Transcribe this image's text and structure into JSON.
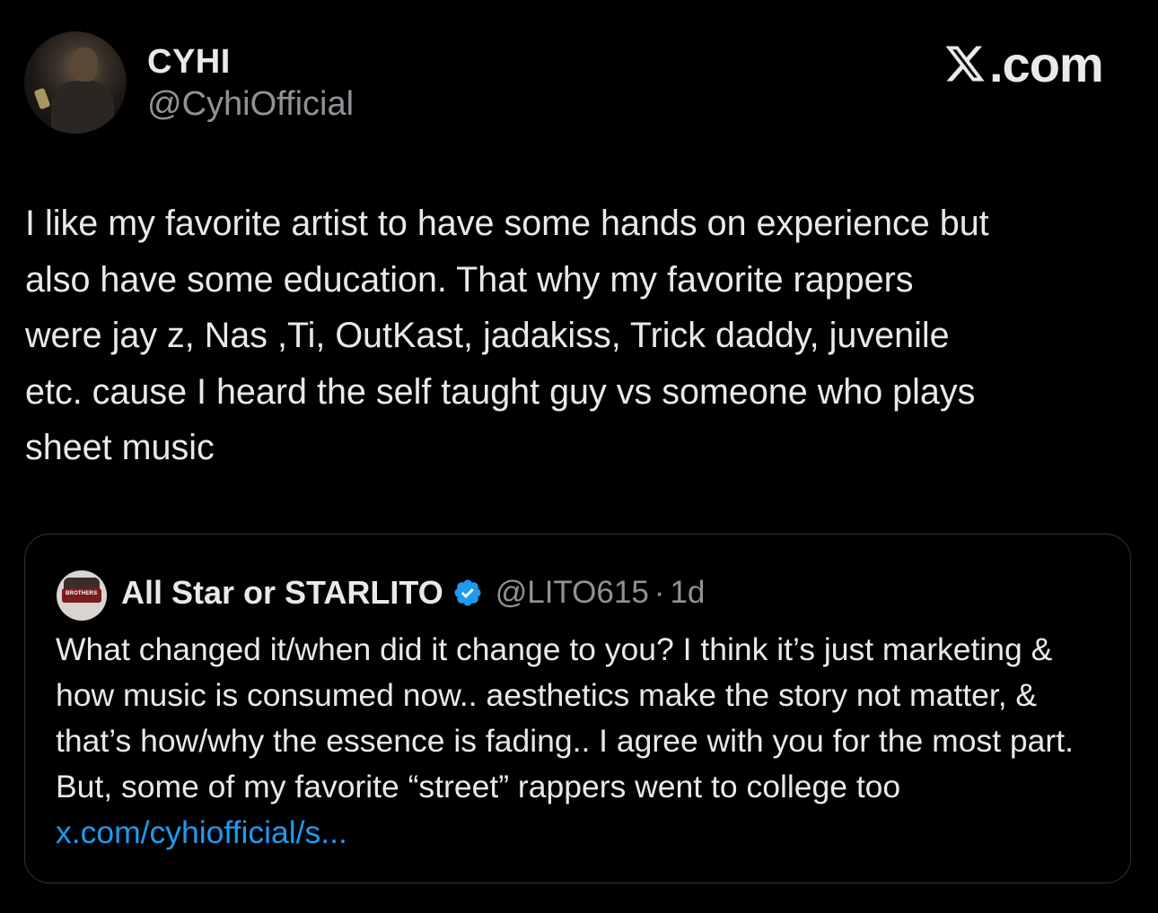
{
  "author": {
    "display_name": "CYHI",
    "handle": "@CyhiOfficial"
  },
  "brand": {
    "label": ".com",
    "icon": "x-logo-icon"
  },
  "tweet": {
    "text": "I like my favorite artist to have some hands on experience but\nalso have some education. That why my favorite rappers\nwere jay z, Nas ,Ti, OutKast, jadakiss, Trick daddy, juvenile\netc. cause I heard the self taught guy vs someone who plays\nsheet music"
  },
  "quoted_tweet": {
    "display_name": "All Star or STARLITO",
    "verified_icon": "verified-badge-icon",
    "avatar_text": "BROTHERS",
    "handle": "@LITO615",
    "separator": "·",
    "time": "1d",
    "text": "What changed it/when did it change to you?  I think it’s just marketing & how music is consumed now.. aesthetics make the story not matter, & that’s how/why the essence is fading.. I agree with you for the most part. But, some of my favorite “street” rappers went to college too ",
    "link_text": "x.com/cyhiofficial/s..."
  },
  "colors": {
    "background": "#000000",
    "text": "#e7e9ea",
    "secondary_text": "#8f9296",
    "link": "#1d9bf0",
    "verified": "#1d9bf0",
    "border": "#2f3336"
  }
}
